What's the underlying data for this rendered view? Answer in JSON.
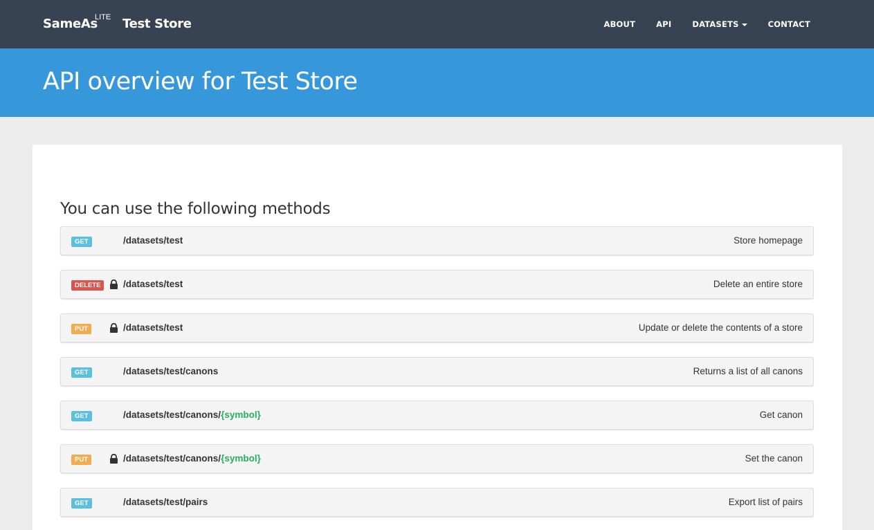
{
  "navbar": {
    "brand": "SameAs",
    "brand_sup": "LITE",
    "store_name": "Test Store",
    "items": [
      {
        "label": "ABOUT"
      },
      {
        "label": "API"
      },
      {
        "label": "DATASETS"
      },
      {
        "label": "CONTACT"
      }
    ]
  },
  "header": {
    "title": "API overview for Test Store"
  },
  "main": {
    "heading": "You can use the following methods",
    "methods": [
      {
        "method": "GET",
        "locked": false,
        "path": "/datasets/test",
        "param": "",
        "description": "Store homepage"
      },
      {
        "method": "DELETE",
        "locked": true,
        "path": "/datasets/test",
        "param": "",
        "description": "Delete an entire store"
      },
      {
        "method": "PUT",
        "locked": true,
        "path": "/datasets/test",
        "param": "",
        "description": "Update or delete the contents of a store"
      },
      {
        "method": "GET",
        "locked": false,
        "path": "/datasets/test/canons",
        "param": "",
        "description": "Returns a list of all canons"
      },
      {
        "method": "GET",
        "locked": false,
        "path": "/datasets/test/canons/",
        "param": "{symbol}",
        "description": "Get canon"
      },
      {
        "method": "PUT",
        "locked": true,
        "path": "/datasets/test/canons/",
        "param": "{symbol}",
        "description": "Set the canon"
      },
      {
        "method": "GET",
        "locked": false,
        "path": "/datasets/test/pairs",
        "param": "",
        "description": "Export list of pairs"
      }
    ]
  },
  "colors": {
    "navbar": "#374352",
    "header": "#3698db",
    "get": "#5bc0de",
    "put": "#f0ad4e",
    "delete": "#d9534f",
    "param": "#27ae60"
  }
}
